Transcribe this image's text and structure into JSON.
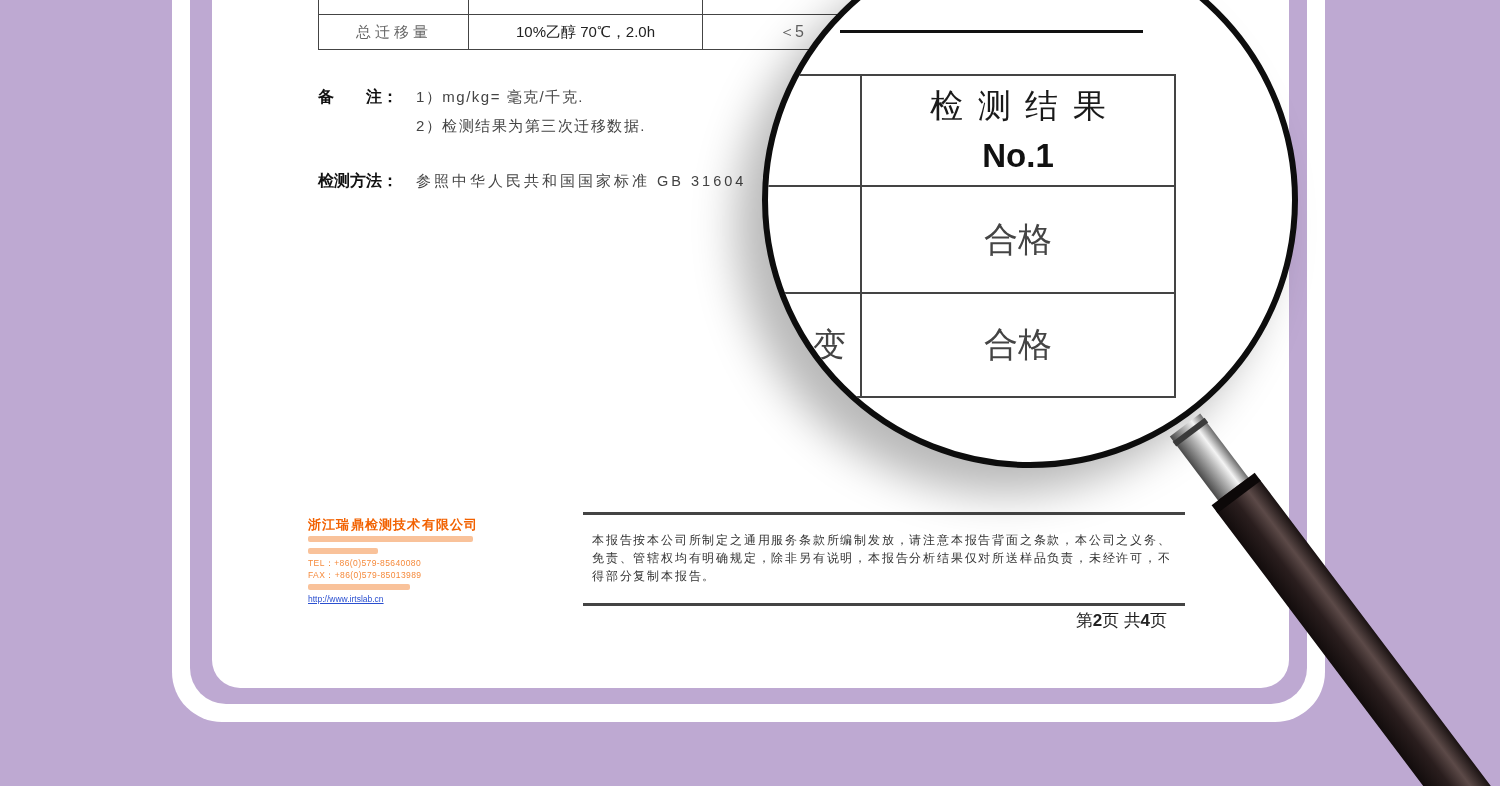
{
  "document": {
    "table": {
      "rows": [
        {
          "column_1": "总迁移量",
          "column_2": "10%乙醇 70℃，2.0h",
          "column_3": "＜5"
        }
      ]
    },
    "notes": {
      "label": "备　　注：",
      "lines": [
        "1）mg/kg= 毫克/千克.",
        "2）检测结果为第三次迁移数据."
      ]
    },
    "method": {
      "label": "检测方法：",
      "text": "参照中华人民共和国国家标准 GB 31604"
    },
    "company": {
      "name": "浙江瑞鼎检测技术有限公司",
      "lines": [
        {
          "kind": "illegible"
        },
        {
          "kind": "illegible"
        },
        {
          "kind": "text",
          "text": "TEL：+86(0)579-85640080"
        },
        {
          "kind": "text",
          "text": "FAX：+86(0)579-85013989"
        },
        {
          "kind": "illegible"
        },
        {
          "kind": "link",
          "text": "http://www.irtslab.cn"
        }
      ]
    },
    "disclaimer": "本报告按本公司所制定之通用服务条款所编制发放，请注意本报告背面之条款，本公司之义务、免责、管辖权均有明确规定，除非另有说明，本报告分析结果仅对所送样品负责，未经许可，不得部分复制本报告。",
    "page_number": "第**2**页 共**4**页"
  },
  "magnifier": {
    "table": {
      "heading": [
        "检测结果",
        "No.1"
      ],
      "rows": [
        {
          "result": "合格"
        },
        {
          "column_1": "变",
          "result": "合格"
        }
      ]
    }
  }
}
